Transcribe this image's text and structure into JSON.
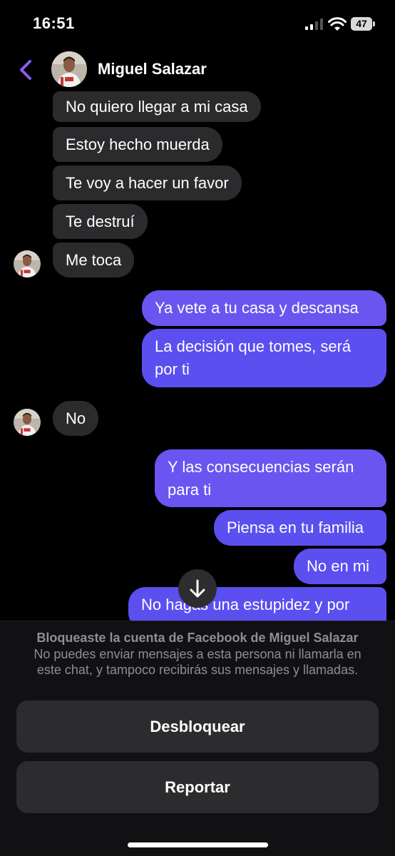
{
  "status_bar": {
    "time": "16:51",
    "battery": "47"
  },
  "header": {
    "contact_name": "Miguel Salazar"
  },
  "messages": {
    "m1": "No quiero llegar a mi casa",
    "m2": "Estoy hecho muerda",
    "m3": "Te voy a hacer un favor",
    "m4": "Te destruí",
    "m5": "Me toca",
    "m6": "Ya vete a tu casa y descansa",
    "m7": "La decisión que tomes, será por ti",
    "m8": "No",
    "m9": "Y las consecuencias serán para ti",
    "m10": "Piensa en tu familia",
    "m11": "No en mi",
    "m12": "No hagas una estupidez y por"
  },
  "blocked_notice": {
    "title": "Bloqueaste la cuenta de Facebook de Miguel Salazar",
    "text": "No puedes enviar mensajes a esta persona ni llamarla en este chat, y tampoco recibirás sus mensajes y llamadas."
  },
  "buttons": {
    "unblock": "Desbloquear",
    "report": "Reportar"
  },
  "colors": {
    "accent": "#8b5cf6",
    "outgoing_bubble": "#5b4ff0",
    "incoming_bubble": "#2b2b2d",
    "background": "#000000"
  },
  "icons": {
    "back": "chevron-left-icon",
    "scroll": "arrow-down-icon",
    "signal": "signal-icon",
    "wifi": "wifi-icon",
    "battery": "battery-icon"
  }
}
